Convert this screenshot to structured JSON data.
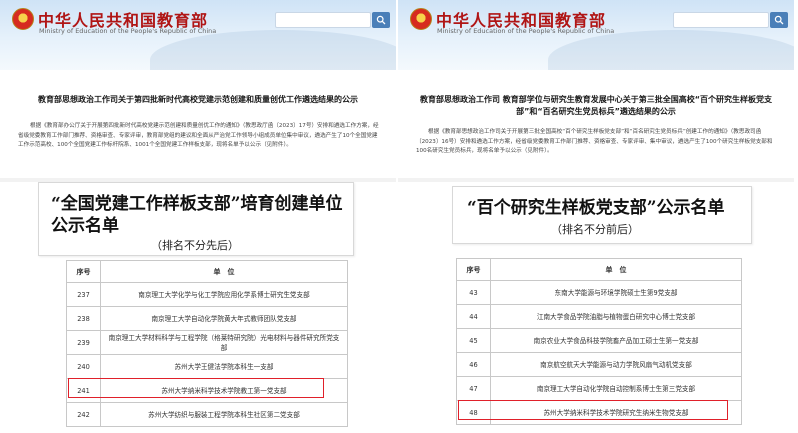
{
  "left": {
    "site_title": "中华人民共和国教育部",
    "site_sub": "Ministry of Education of the People's Republic of China",
    "article_title": "教育部思想政治工作司关于第四批新时代高校党建示范创建和质量创优工作遴选结果的公示",
    "article_body": "根据《教育部办公厅关于开展第四批新时代高校党建示范创建和质量创优工作的通知》（教思政厅函〔2023〕17号）安排和遴选工作方案，经省级党委教育工作部门推荐、资格审查、专家评审，教育部党组的建议和全面从严治党工作领导小组成员单位集中审议，遴选产生了10个全国党建工作示范高校、100个全国党建工作标杆院系、1001个全国党建工作样板支部，现将名单予以公示（见附件）。",
    "doc_heading_line1": "“全国党建工作样板支部”培育创建单位",
    "doc_heading_line2": "公示名单",
    "doc_note": "（排名不分先后）",
    "table": {
      "headers": [
        "序号",
        "单　位"
      ],
      "rows": [
        {
          "no": "237",
          "name": "南京理工大学化学与化工学院应用化学系博士研究生党支部"
        },
        {
          "no": "238",
          "name": "南京理工大学自动化学院黄大年式教师团队党支部"
        },
        {
          "no": "239",
          "name": "南京理工大学材料科学与工程学院（格莱特研究院）光电材料与器件研究所党支部"
        },
        {
          "no": "240",
          "name": "苏州大学王健法学院本科生一支部"
        },
        {
          "no": "241",
          "name": "苏州大学纳米科学技术学院教工第一党支部"
        },
        {
          "no": "242",
          "name": "苏州大学纺织与服装工程学院本科生社区第二党支部"
        }
      ]
    }
  },
  "right": {
    "site_title": "中华人民共和国教育部",
    "site_sub": "Ministry of Education of the People's Republic of China",
    "article_title": "教育部思想政治工作司 教育部学位与研究生教育发展中心关于第三批全国高校“百个研究生样板党支部”和“百名研究生党员标兵”遴选结果的公示",
    "article_body": "根据《教育部思想政治工作司关于开展第三批全国高校“百个研究生样板党支部”和“百名研究生党员标兵”创建工作的通知》（教思政司函〔2023〕16号）安排和遴选工作方案，经省级党委教育工作部门推荐、资格审查、专家评审、集中审议，遴选产生了100个研究生样板党支部和100名研究生党员标兵，现将名单予以公示（见附件）。",
    "doc_heading_line1": "“百个研究生样板党支部”公示名单",
    "doc_note": "（排名不分前后）",
    "table": {
      "headers": [
        "序号",
        "单　位"
      ],
      "rows": [
        {
          "no": "43",
          "name": "东南大学能源与环境学院硕士生第9党支部"
        },
        {
          "no": "44",
          "name": "江南大学食品学院油脂与植物蛋白研究中心博士党支部"
        },
        {
          "no": "45",
          "name": "南京农业大学食品科技学院畜产品加工硕士生第一党支部"
        },
        {
          "no": "46",
          "name": "南京航空航天大学能源与动力学院风扇气动机党支部"
        },
        {
          "no": "47",
          "name": "南京理工大学自动化学院自动控制系博士生第三党支部"
        },
        {
          "no": "48",
          "name": "苏州大学纳米科学技术学院研究生纳米生物党支部"
        }
      ]
    }
  }
}
